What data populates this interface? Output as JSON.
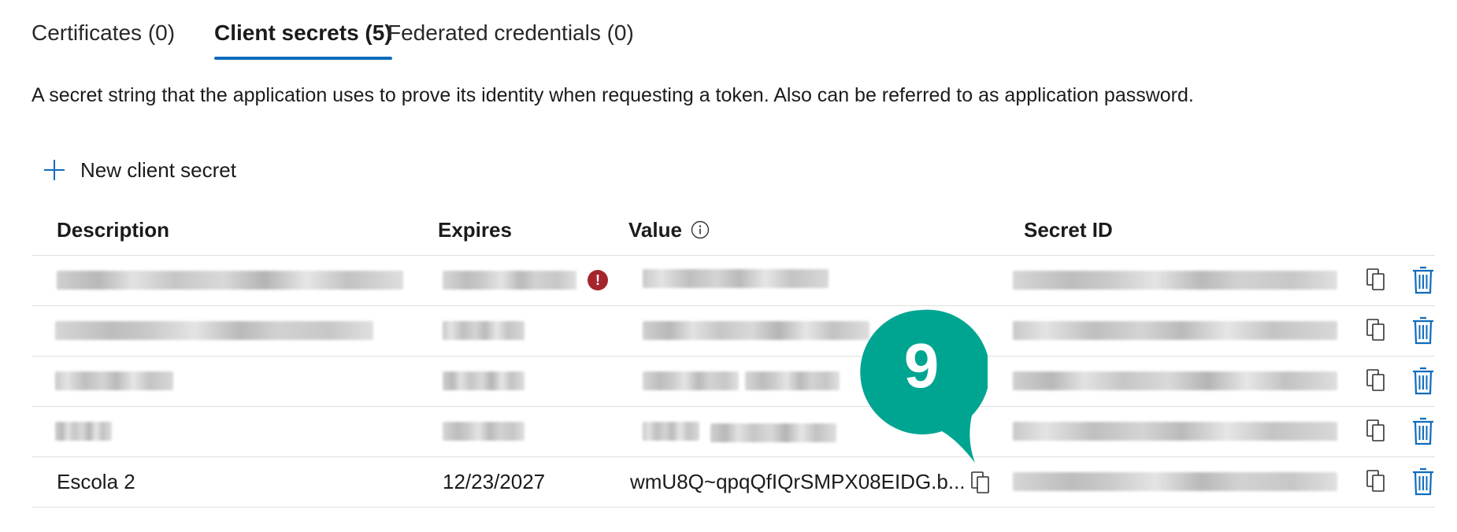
{
  "tabs": [
    {
      "label": "Certificates (0)",
      "active": false
    },
    {
      "label": "Client secrets (5)",
      "active": true
    },
    {
      "label": "Federated credentials (0)",
      "active": false
    }
  ],
  "description": "A secret string that the application uses to prove its identity when requesting a token. Also can be referred to as application password.",
  "toolbar": {
    "new_secret_label": "New client secret"
  },
  "table": {
    "columns": {
      "description": "Description",
      "expires": "Expires",
      "value": "Value",
      "secret_id": "Secret ID"
    },
    "visible_row": {
      "description": "Escola 2",
      "expires": "12/23/2027",
      "value": "wmU8Q~qpqQfIQrSMPX08EIDG.b..."
    },
    "redacted_rows": 4
  },
  "callout": {
    "number": "9",
    "color": "#00a591"
  },
  "colors": {
    "accent": "#0f6cbd",
    "error": "#a4262c"
  },
  "icons": [
    "plus-icon",
    "info-icon",
    "error-icon",
    "copy-icon",
    "trash-icon"
  ]
}
